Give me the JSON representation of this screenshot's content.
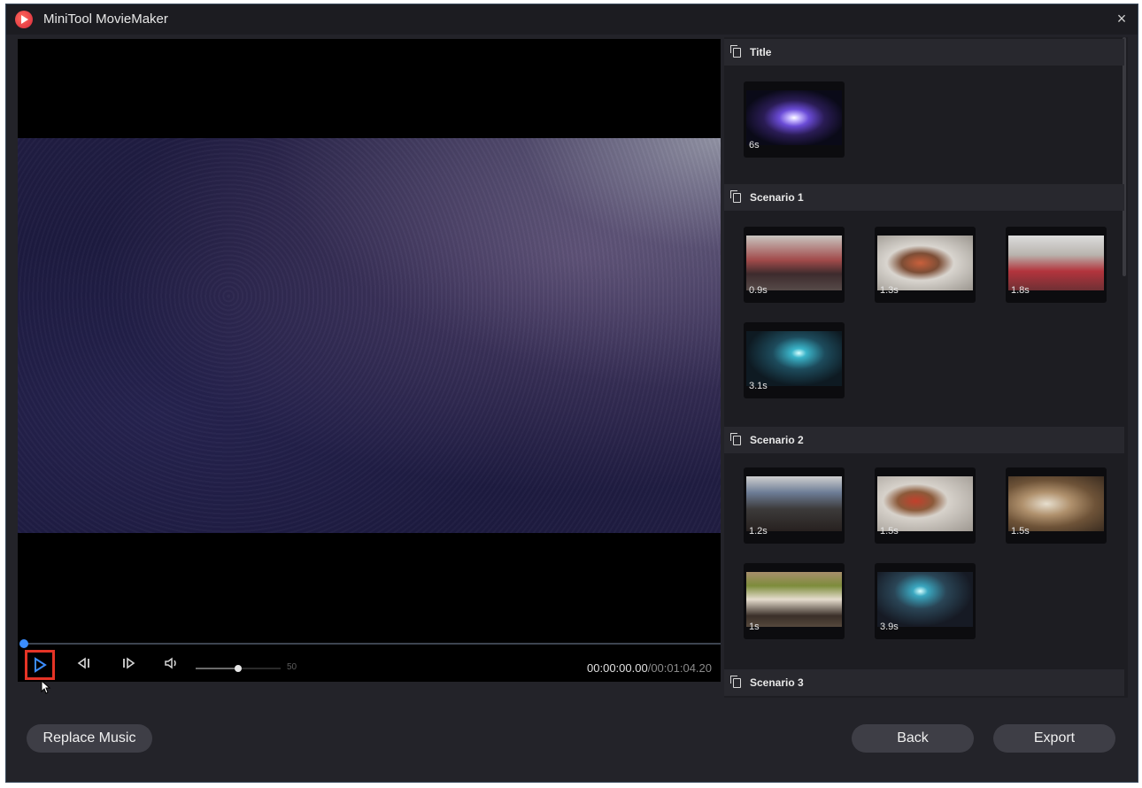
{
  "window": {
    "title": "MiniTool MovieMaker",
    "close_icon": "×"
  },
  "player": {
    "volume_value": "50",
    "volume_level": 0.5,
    "current_time": "00:00:00.00",
    "total_time": "/00:01:04.20",
    "progress": 0
  },
  "panel": {
    "sections": [
      {
        "title": "Title",
        "clips": [
          {
            "duration": "6s"
          }
        ]
      },
      {
        "title": "Scenario 1",
        "clips": [
          {
            "duration": "0.9s"
          },
          {
            "duration": "1.3s"
          },
          {
            "duration": "1.8s"
          },
          {
            "duration": "3.1s"
          }
        ]
      },
      {
        "title": "Scenario 2",
        "clips": [
          {
            "duration": "1.2s"
          },
          {
            "duration": "1.5s"
          },
          {
            "duration": "1.5s"
          },
          {
            "duration": "1s"
          },
          {
            "duration": "3.9s"
          }
        ]
      },
      {
        "title": "Scenario 3",
        "clips": []
      }
    ]
  },
  "buttons": {
    "replace_music": "Replace Music",
    "back": "Back",
    "export": "Export"
  },
  "colors": {
    "accent": "#3b8dff",
    "highlight": "#e53426"
  }
}
